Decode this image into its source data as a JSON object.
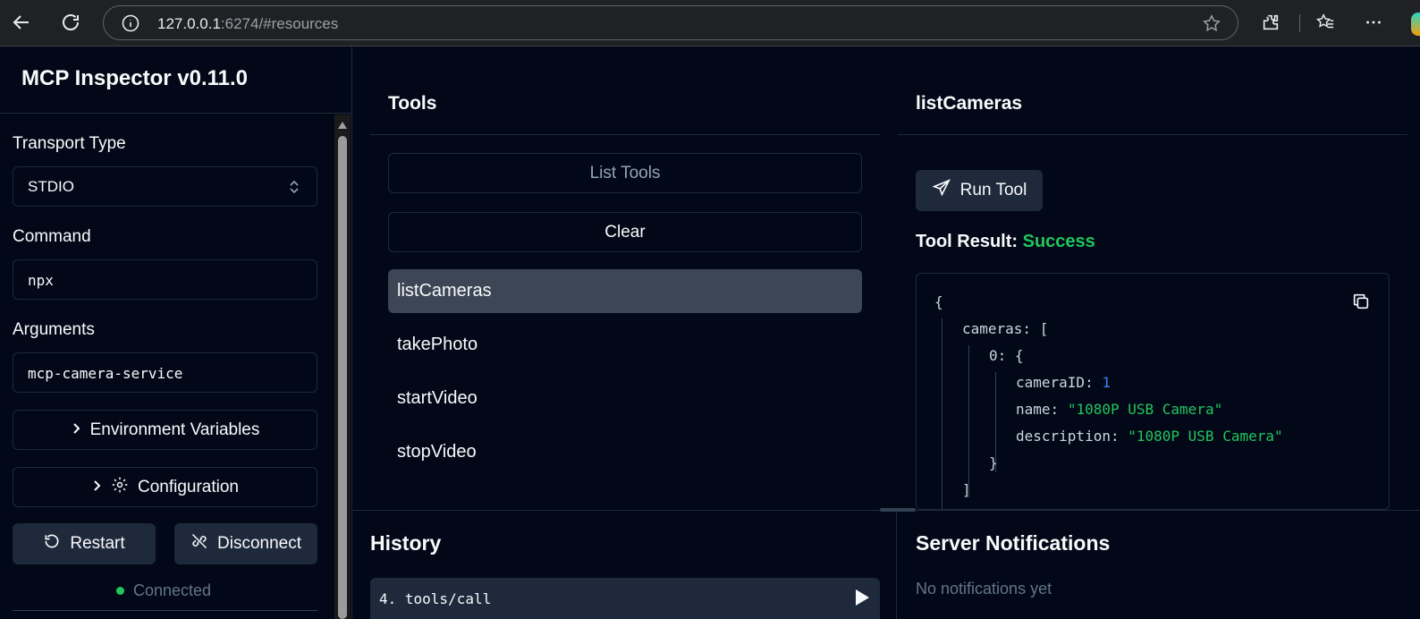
{
  "browser": {
    "url_host": "127.0.0.1",
    "url_rest": ":6274/#resources",
    "icons": [
      "back-icon",
      "reload-icon",
      "info-icon",
      "star-icon",
      "extensions-icon",
      "favorites-icon",
      "more-icon"
    ]
  },
  "sidebar": {
    "title": "MCP Inspector v0.11.0",
    "transport_label": "Transport Type",
    "transport_value": "STDIO",
    "command_label": "Command",
    "command_value": "npx",
    "arguments_label": "Arguments",
    "arguments_value": "mcp-camera-service",
    "env_button": "Environment Variables",
    "config_button": "Configuration",
    "restart_button": "Restart",
    "disconnect_button": "Disconnect",
    "status": "Connected",
    "status_color": "#22c55e"
  },
  "tools_panel": {
    "title": "Tools",
    "list_button": "List Tools",
    "clear_button": "Clear",
    "items": [
      "listCameras",
      "takePhoto",
      "startVideo",
      "stopVideo"
    ],
    "selected": "listCameras"
  },
  "detail_panel": {
    "title": "listCameras",
    "run_button": "Run Tool",
    "result_label": "Tool Result:",
    "result_status": "Success",
    "json": {
      "open_brace": "{",
      "cameras_key": "cameras:",
      "open_bracket": "[",
      "index_key": "0:",
      "inner_open": "{",
      "camera_id_key": "cameraID:",
      "camera_id_value": "1",
      "name_key": "name:",
      "name_value": "\"1080P USB Camera\"",
      "description_key": "description:",
      "description_value": "\"1080P USB Camera\"",
      "inner_close": "}",
      "close_bracket": "]"
    }
  },
  "history": {
    "title": "History",
    "entries": [
      "4. tools/call"
    ]
  },
  "notifications": {
    "title": "Server Notifications",
    "empty_text": "No notifications yet"
  }
}
